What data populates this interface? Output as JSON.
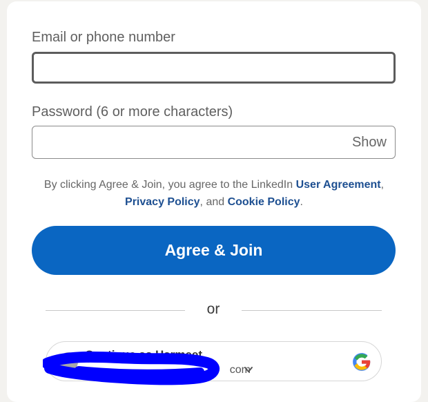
{
  "form": {
    "email_label": "Email or phone number",
    "email_value": "",
    "password_label": "Password (6 or more characters)",
    "password_value": "",
    "show_label": "Show"
  },
  "legal": {
    "prefix": "By clicking Agree & Join, you agree to the LinkedIn ",
    "user_agreement": "User Agreement",
    "comma": ", ",
    "privacy_policy": "Privacy Policy",
    "and": ", and ",
    "cookie_policy": "Cookie Policy",
    "suffix": "."
  },
  "join_button_label": "Agree & Join",
  "divider_text": "or",
  "google_account": {
    "name": "Continue as Harmeet",
    "email_suffix": "com",
    "icon": "google-icon",
    "chevron": "chevron-down-icon"
  },
  "colors": {
    "primary_button": "#0a66c2",
    "link": "#1d4f91",
    "redaction": "#0000ff"
  }
}
